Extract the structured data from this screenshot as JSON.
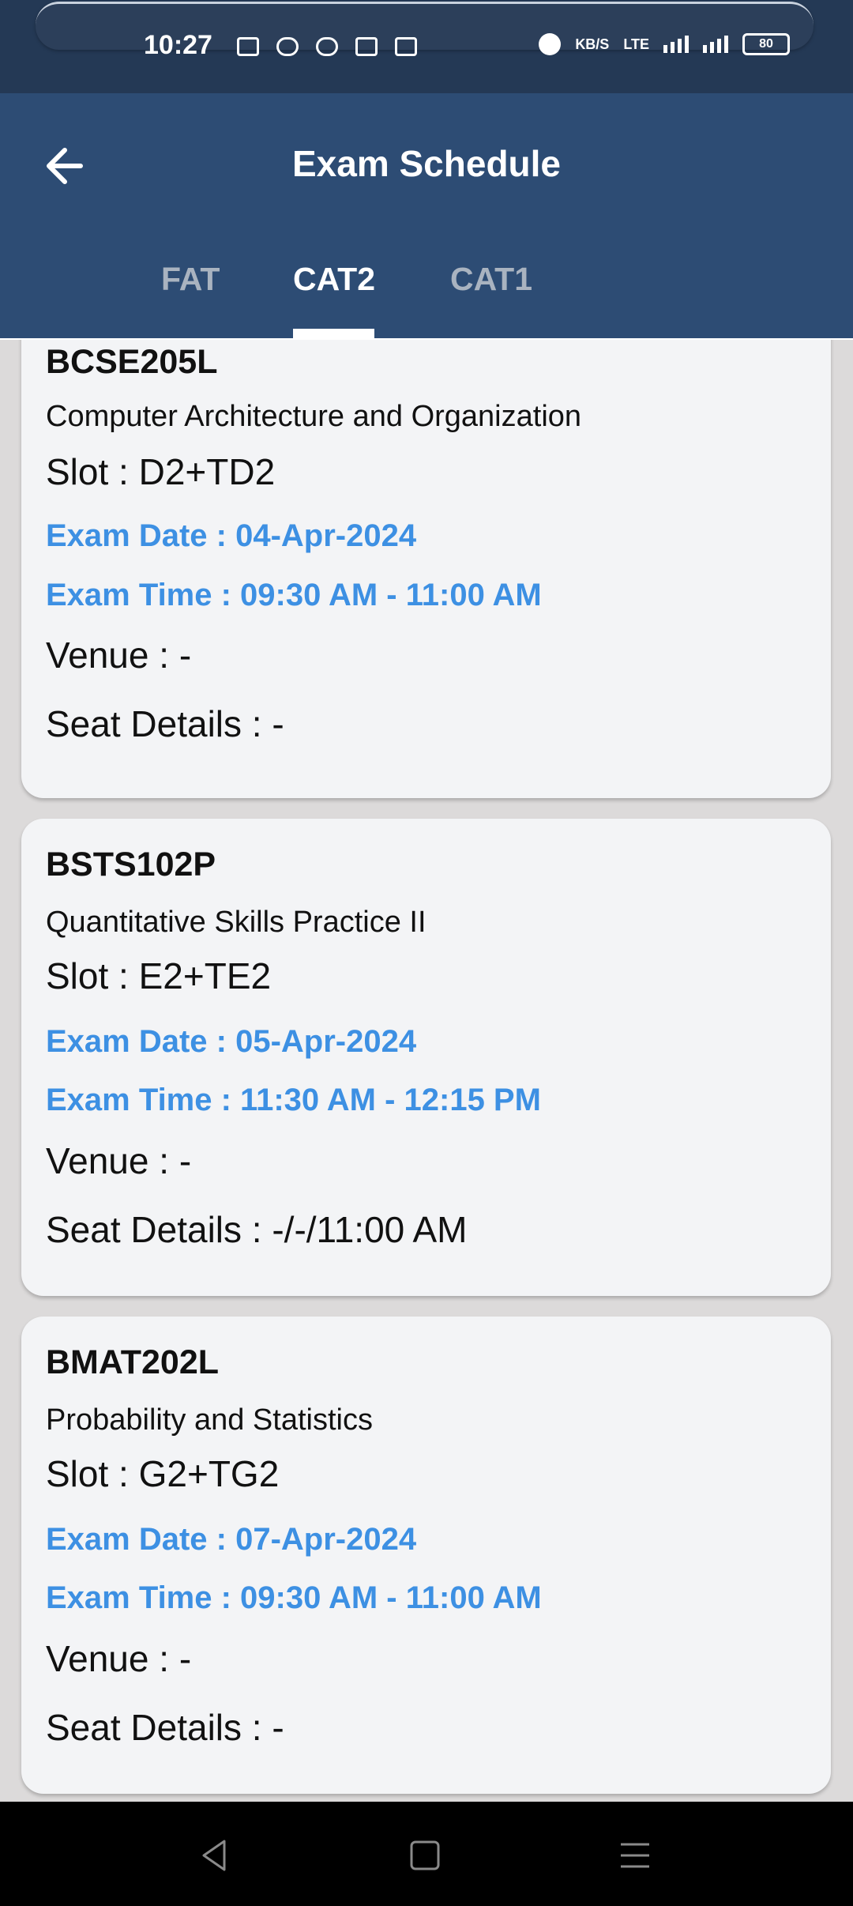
{
  "status": {
    "time": "10:27",
    "speed_unit": "KB/S",
    "network": "LTE",
    "battery": "80"
  },
  "header": {
    "title": "Exam Schedule",
    "back_icon": "arrow-left-icon"
  },
  "tabs": [
    {
      "label": "FAT",
      "active": false
    },
    {
      "label": "CAT2",
      "active": true
    },
    {
      "label": "CAT1",
      "active": false
    }
  ],
  "exams": [
    {
      "code": "BCSE205L",
      "course": "Computer Architecture and Organization",
      "slot": "Slot : D2+TD2",
      "date": "Exam Date : 04-Apr-2024",
      "time": "Exam Time : 09:30 AM - 11:00 AM",
      "venue": "Venue : -",
      "seat": "Seat Details : -"
    },
    {
      "code": "BSTS102P",
      "course": "Quantitative Skills Practice II",
      "slot": "Slot : E2+TE2",
      "date": "Exam Date : 05-Apr-2024",
      "time": "Exam Time : 11:30 AM - 12:15 PM",
      "venue": "Venue : -",
      "seat": "Seat Details : -/-/11:00 AM"
    },
    {
      "code": "BMAT202L",
      "course": "Probability and Statistics",
      "slot": "Slot : G2+TG2",
      "date": "Exam Date : 07-Apr-2024",
      "time": "Exam Time : 09:30 AM - 11:00 AM",
      "venue": "Venue : -",
      "seat": "Seat Details : -"
    }
  ],
  "navbar": {
    "icons": [
      "back-triangle-icon",
      "home-square-icon",
      "menu-lines-icon"
    ]
  },
  "colors": {
    "header": "#2d4c74",
    "status_bar": "#243955",
    "accent_blue": "#3d90e3",
    "card": "#f3f4f6",
    "background": "#dcdada"
  }
}
